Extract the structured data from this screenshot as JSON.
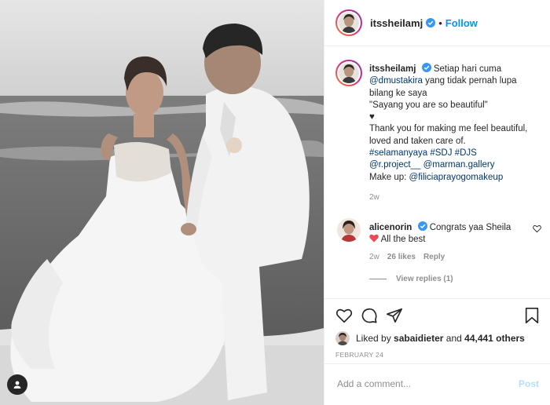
{
  "post": {
    "username": "itssheilamj",
    "follow_label": "Follow",
    "separator": "•",
    "caption": {
      "username": "itssheilamj",
      "line1": "Setiap hari cuma",
      "mention1": "@dmustakira",
      "line2": "yang tidak pernah lupa bilang ke saya",
      "line3": "\"Sayang you are so beautiful\"",
      "line4": "♥",
      "line5": "Thank you for making me feel beautiful, loved and taken care of.",
      "hashtag1": "#selamanyaya",
      "hashtag2": "#SDJ",
      "hashtag3": "#DJS",
      "mention2": "@r.project__",
      "mention3": "@marman.gallery",
      "makeup_label": "Make up:",
      "mention4": "@filiciaprayogomakeup",
      "time": "2w"
    },
    "comment": {
      "username": "alicenorin",
      "text": "Congrats yaa Sheila",
      "line2": "All the best",
      "time": "2w",
      "likes": "26 likes",
      "reply_label": "Reply",
      "view_replies": "View replies (1)"
    },
    "likes": {
      "prefix": "Liked by",
      "liker": "sabaidieter",
      "conj": "and",
      "count": "44,441 others"
    },
    "date": "FEBRUARY 24",
    "add_comment": {
      "placeholder": "Add a comment...",
      "post_label": "Post"
    }
  },
  "icons": {
    "verified": "verified-badge-icon",
    "heart": "heart-icon",
    "comment": "comment-icon",
    "share": "share-icon",
    "save": "bookmark-icon",
    "tag": "user-tag-icon"
  },
  "colors": {
    "link": "#00376b",
    "follow": "#0095f6",
    "verified": "#3897f0",
    "heart_red": "#ed4956",
    "post_disabled": "#b2dffc"
  }
}
